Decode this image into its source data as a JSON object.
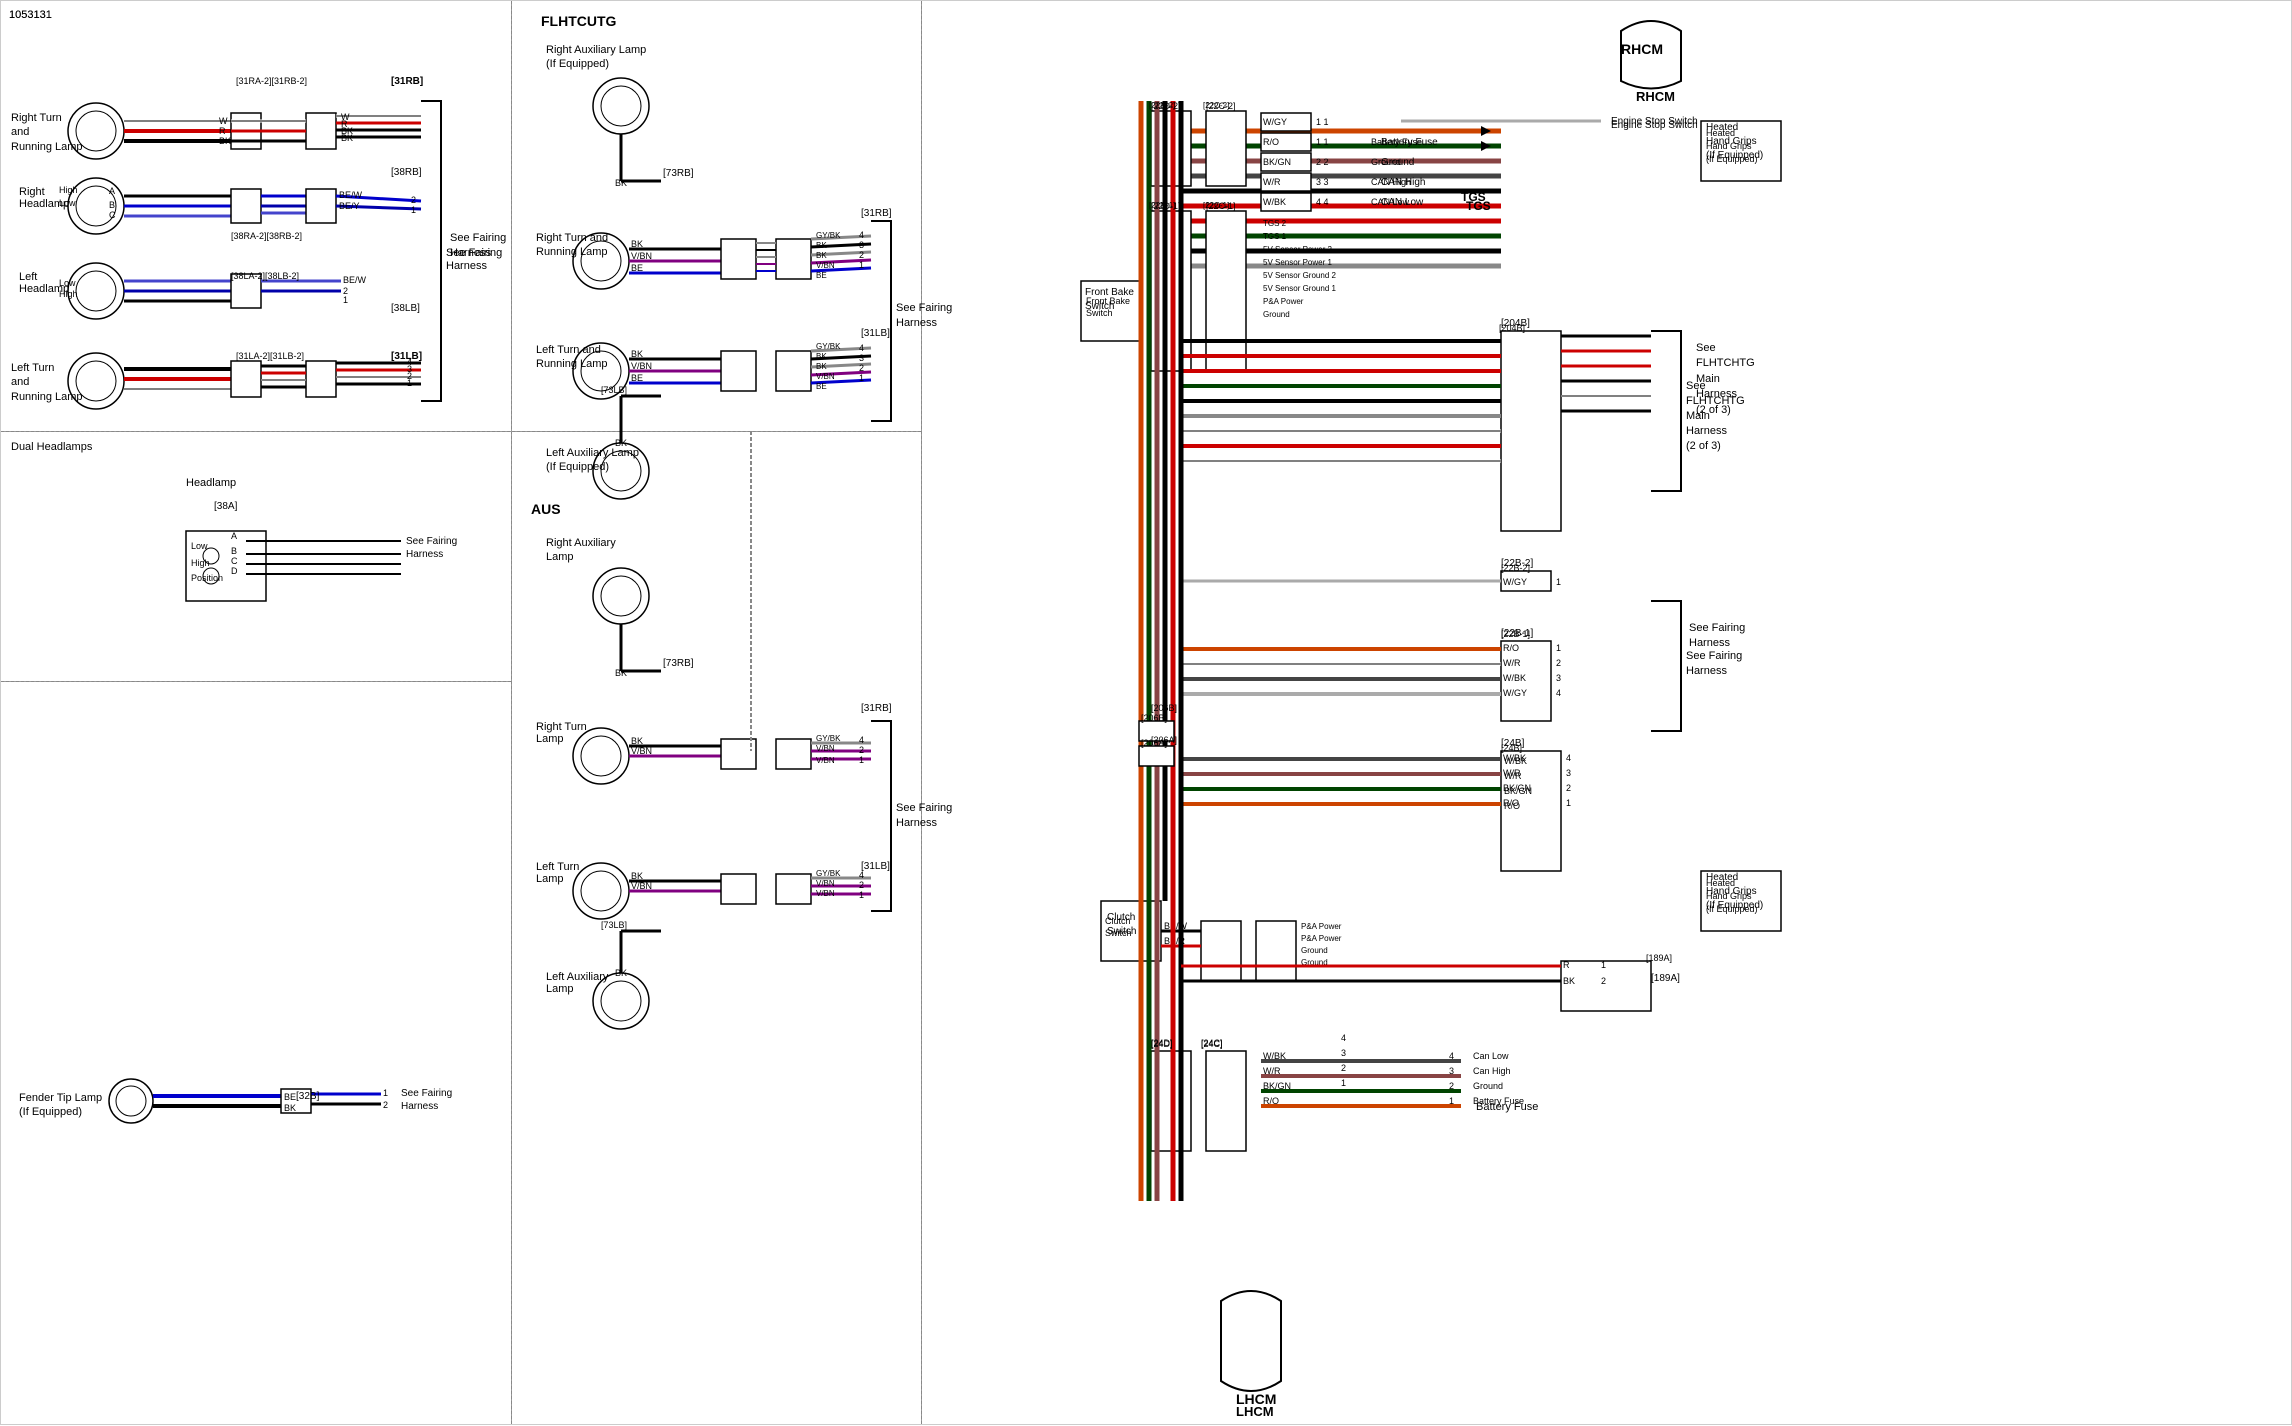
{
  "doc_id": "1053131",
  "sections": {
    "top_left_header": "Dual Headlamps",
    "center_top_header": "FLHTCUTG",
    "center_bottom_header": "AUS",
    "right_header": "RHCM"
  },
  "labels": {
    "battery_fuse": "Battery Fuse",
    "ground": "Ground",
    "can_high": "CAN High",
    "can_low": "CAN Low",
    "tgs": "TGS",
    "heated_hand_grips": "Heated\nHand Grips\n(If Equipped)",
    "front_brake_switch": "Front Bake\nSwitch",
    "clutch_switch": "Clutch\nSwitch",
    "lhcm": "LHCM",
    "rhcm": "RHCM",
    "engine_stop_switch": "Engine Stop Switch",
    "see_fairing_harness": "See Fairing\nHarness",
    "see_flhtchtg_main_harness": "See\nFLHTCHTG\nMain\nHarness\n(2 of 3)",
    "right_turn_running_lamp": "Right Turn\nand\nRunning Lamp",
    "left_turn_running_lamp": "Left Turn\nand\nRunning Lamp",
    "right_headlamp": "Right\nHeadlamp",
    "left_headlamp": "Left\nHeadlamp",
    "left_turn_running_lamp2": "Left Turn\nand\nRunning Lamp",
    "right_aux_lamp": "Right Auxiliary Lamp\n(If Equipped)",
    "left_aux_lamp": "Left Auxiliary Lamp\n(If Equipped)",
    "right_turn_lamp_aus": "Right Turn\nLamp",
    "left_turn_lamp_aus": "Left Turn\nLamp",
    "right_aux_lamp_aus": "Right Auxiliary\nLamp",
    "left_aux_lamp_aus": "Left Auxiliary\nLamp",
    "fender_tip_lamp": "Fender Tip Lamp\n(If Equipped)",
    "headlamp": "Headlamp",
    "38a": "[38A]",
    "32b": "[32B]",
    "31rb": "[31RB]",
    "31lb": "[31LB]",
    "38rb": "[38RB]",
    "38lb": "[38LB]"
  },
  "colors": {
    "wire_red": "#cc0000",
    "wire_black": "#000000",
    "wire_blue": "#0000cc",
    "wire_white": "#ffffff",
    "wire_gray": "#888888",
    "wire_violet": "#800080",
    "wire_green": "#006400",
    "wire_orange": "#cc6600",
    "wire_brown": "#8b4513",
    "wire_tan": "#d2b48c",
    "wire_gyBK": "#888888",
    "wire_vBN": "#800080",
    "wire_BE": "#0000cc",
    "wire_BEW": "#0000aa",
    "wire_BEY": "#4444cc",
    "wire_WGY": "#aaaaaa",
    "wire_RO": "#cc4400",
    "wire_BKGN": "#004400",
    "wire_WR": "#884444",
    "wire_WBK": "#444444",
    "bg": "#ffffff",
    "border": "#000000"
  }
}
